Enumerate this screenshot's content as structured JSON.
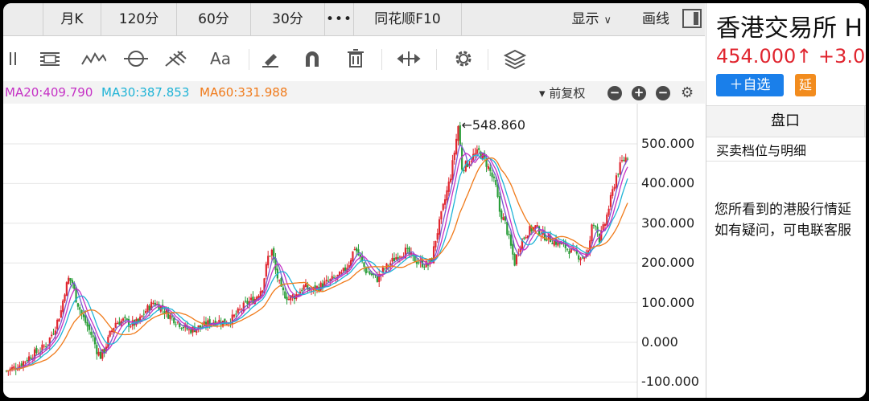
{
  "periods": [
    "",
    "月K",
    "120分",
    "60分",
    "30分",
    "•••",
    "同花顺F10"
  ],
  "toolbar_right": {
    "display": "显示",
    "draw": "画线"
  },
  "ma": {
    "ma20": "MA20:409.790",
    "ma30": "MA30:387.853",
    "ma60": "MA60:331.988",
    "color_ma20": "#c531c5",
    "color_ma30": "#1fb3d6",
    "color_ma60": "#f07a1a"
  },
  "adjust": "前复权",
  "adjust_arrow": "▾",
  "zoom_buttons": [
    "−",
    "+",
    "−"
  ],
  "chart_data": {
    "type": "line",
    "kind": "candlestick",
    "yticks": [
      "500.000",
      "400.000",
      "300.000",
      "200.000",
      "100.000",
      "0.000",
      "-100.000"
    ],
    "ylim": [
      -100,
      560
    ],
    "peak_label": "←548.860",
    "peak_value": 548.86,
    "close_path": [
      [
        0,
        -72
      ],
      [
        6,
        -60
      ],
      [
        10,
        -45
      ],
      [
        14,
        -30
      ],
      [
        18,
        -20
      ],
      [
        22,
        0
      ],
      [
        26,
        40
      ],
      [
        29,
        80
      ],
      [
        31,
        130
      ],
      [
        33,
        160
      ],
      [
        35,
        150
      ],
      [
        37,
        110
      ],
      [
        40,
        70
      ],
      [
        43,
        40
      ],
      [
        46,
        10
      ],
      [
        48,
        -20
      ],
      [
        50,
        -35
      ],
      [
        52,
        -20
      ],
      [
        55,
        20
      ],
      [
        58,
        50
      ],
      [
        62,
        55
      ],
      [
        66,
        45
      ],
      [
        70,
        50
      ],
      [
        74,
        80
      ],
      [
        78,
        100
      ],
      [
        82,
        90
      ],
      [
        86,
        70
      ],
      [
        90,
        55
      ],
      [
        94,
        40
      ],
      [
        97,
        30
      ],
      [
        100,
        35
      ],
      [
        104,
        40
      ],
      [
        108,
        50
      ],
      [
        112,
        55
      ],
      [
        116,
        50
      ],
      [
        120,
        60
      ],
      [
        124,
        80
      ],
      [
        128,
        100
      ],
      [
        132,
        110
      ],
      [
        136,
        140
      ],
      [
        139,
        215
      ],
      [
        141,
        230
      ],
      [
        143,
        180
      ],
      [
        146,
        130
      ],
      [
        150,
        110
      ],
      [
        154,
        120
      ],
      [
        158,
        140
      ],
      [
        162,
        130
      ],
      [
        166,
        140
      ],
      [
        170,
        150
      ],
      [
        174,
        160
      ],
      [
        178,
        170
      ],
      [
        182,
        200
      ],
      [
        185,
        240
      ],
      [
        188,
        210
      ],
      [
        191,
        180
      ],
      [
        194,
        170
      ],
      [
        197,
        160
      ],
      [
        200,
        180
      ],
      [
        204,
        200
      ],
      [
        208,
        220
      ],
      [
        212,
        230
      ],
      [
        216,
        210
      ],
      [
        220,
        200
      ],
      [
        224,
        195
      ],
      [
        226,
        210
      ],
      [
        228,
        260
      ],
      [
        230,
        300
      ],
      [
        232,
        340
      ],
      [
        234,
        380
      ],
      [
        236,
        420
      ],
      [
        238,
        480
      ],
      [
        240,
        545
      ],
      [
        242,
        440
      ],
      [
        245,
        450
      ],
      [
        248,
        470
      ],
      [
        251,
        480
      ],
      [
        254,
        460
      ],
      [
        257,
        430
      ],
      [
        260,
        390
      ],
      [
        262,
        330
      ],
      [
        265,
        300
      ],
      [
        267,
        260
      ],
      [
        270,
        200
      ],
      [
        273,
        250
      ],
      [
        277,
        280
      ],
      [
        281,
        290
      ],
      [
        285,
        270
      ],
      [
        289,
        260
      ],
      [
        293,
        250
      ],
      [
        297,
        240
      ],
      [
        300,
        230
      ],
      [
        303,
        220
      ],
      [
        306,
        215
      ],
      [
        309,
        225
      ],
      [
        311,
        290
      ],
      [
        313,
        300
      ],
      [
        315,
        260
      ],
      [
        318,
        300
      ],
      [
        321,
        360
      ],
      [
        324,
        420
      ],
      [
        327,
        455
      ],
      [
        330,
        470
      ]
    ],
    "x_domain": [
      0,
      330
    ],
    "colors": {
      "up": "#e0252f",
      "down": "#2a9e3a",
      "ma20": "#c531c5",
      "ma30": "#1fb3d6",
      "ma60": "#f07a1a",
      "ma10": "#7a57d1"
    }
  },
  "right_panel": {
    "name": "香港交易所 H",
    "price": "454.000↑ +3.0",
    "add_watch": "＋自选",
    "delay": "延",
    "tab": "盘口",
    "subtitle": "买卖档位与明细",
    "msg_line1": "您所看到的港股行情延",
    "msg_line2": "如有疑问，可电联客服"
  }
}
